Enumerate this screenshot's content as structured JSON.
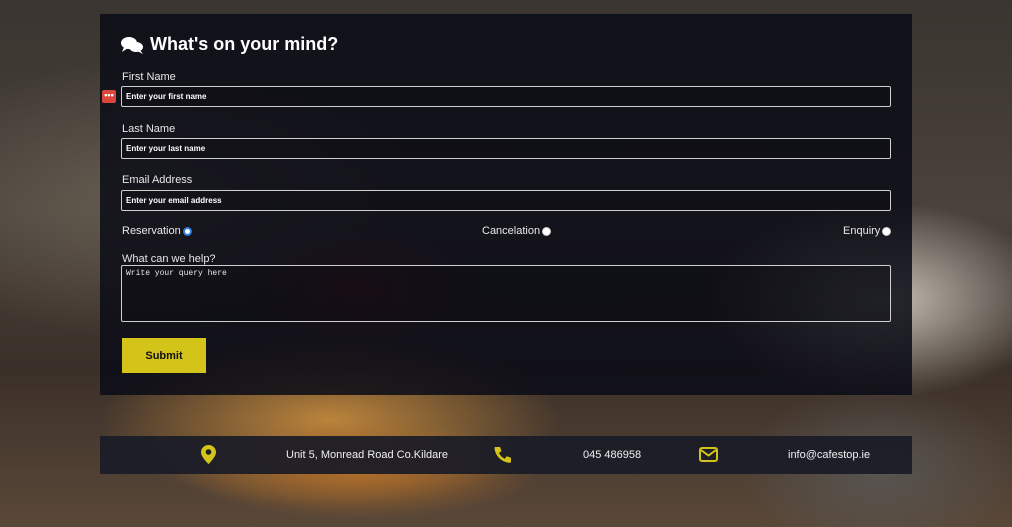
{
  "form": {
    "title": "What's on your mind?",
    "first_name": {
      "label": "First Name",
      "placeholder": "Enter your first name"
    },
    "last_name": {
      "label": "Last Name",
      "placeholder": "Enter your last name"
    },
    "email": {
      "label": "Email Address",
      "placeholder": "Enter your email address"
    },
    "radios": [
      {
        "label": "Reservation",
        "checked": true
      },
      {
        "label": "Cancelation",
        "checked": false
      },
      {
        "label": "Enquiry",
        "checked": false
      }
    ],
    "query": {
      "label": "What can we help?",
      "placeholder": "Write your query here"
    },
    "submit_label": "Submit",
    "badge": "•••"
  },
  "footer": {
    "address": "Unit 5, Monread Road Co.Kildare",
    "phone": "045 486958",
    "email": "info@cafestop.ie"
  },
  "colors": {
    "accent": "#d4c41a",
    "panel": "#0a0c16",
    "badge": "#d9463b",
    "radio": "#2a7de1"
  },
  "icons": [
    "comments-icon",
    "map-marker-icon",
    "phone-icon",
    "envelope-icon"
  ]
}
